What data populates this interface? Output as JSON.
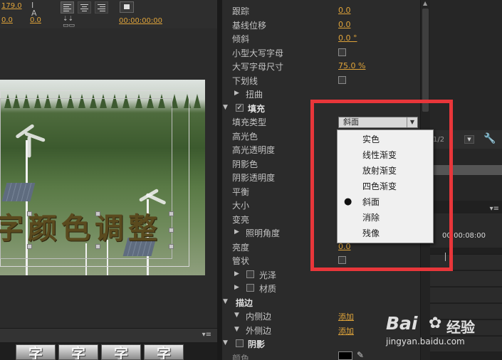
{
  "toolbar": {
    "tracking_val": "179.0",
    "x_val": "0.0",
    "y_val": "0.0",
    "timecode": "00:00:00:00"
  },
  "properties": [
    {
      "label": "跟踪",
      "value": "0.0"
    },
    {
      "label": "基线位移",
      "value": "0.0"
    },
    {
      "label": "倾斜",
      "value": "0.0 °"
    },
    {
      "label": "小型大写字母",
      "checkbox": true
    },
    {
      "label": "大写字母尺寸",
      "value": "75.0 %"
    },
    {
      "label": "下划线",
      "checkbox": true
    },
    {
      "label": "扭曲",
      "collapsed": true
    },
    {
      "label": "填充",
      "section": true,
      "checked": true
    },
    {
      "label": "填充类型"
    },
    {
      "label": "高光色"
    },
    {
      "label": "高光透明度"
    },
    {
      "label": "阴影色"
    },
    {
      "label": "阴影透明度"
    },
    {
      "label": "平衡"
    },
    {
      "label": "大小"
    },
    {
      "label": "变亮"
    },
    {
      "label": "照明角度",
      "collapsed": true
    },
    {
      "label": "亮度",
      "value": "0.0"
    },
    {
      "label": "管状",
      "checkbox": true
    },
    {
      "label": "光泽",
      "collapsed": true,
      "row_checkbox": true
    },
    {
      "label": "材质",
      "collapsed": true,
      "row_checkbox": true
    },
    {
      "label": "描边",
      "section": true
    },
    {
      "label": "内侧边",
      "value": "添加"
    },
    {
      "label": "外侧边",
      "value": "添加"
    },
    {
      "label": "阴影",
      "section": true,
      "row_checkbox": true
    },
    {
      "label": "颜色"
    }
  ],
  "fill_type": {
    "selected": "斜面",
    "options": [
      "实色",
      "线性渐变",
      "放射渐变",
      "四色渐变",
      "斜面",
      "消除",
      "残像"
    ]
  },
  "title_text": "字颜色调整",
  "styles_strip": [
    "字",
    "字",
    "字",
    "字"
  ],
  "timeline": {
    "page_indicator": "1/2",
    "timecode": "00:00:08:00"
  },
  "watermark": {
    "logo": "Bai",
    "logo_cn": "经验",
    "url": "jingyan.baidu.com"
  },
  "colors": {
    "value_orange": "#e0a43a",
    "highlight_red": "#e8363a",
    "menu_bg": "#f0f0f0"
  }
}
